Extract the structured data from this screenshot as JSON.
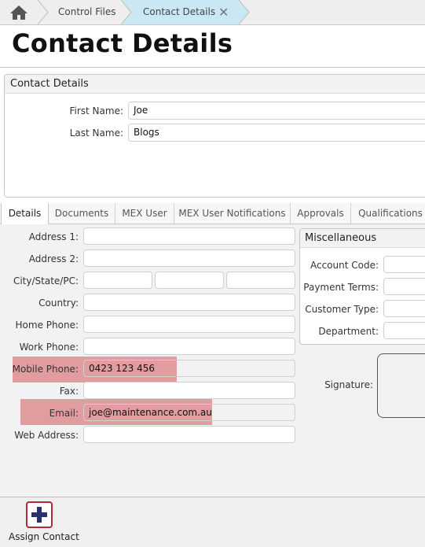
{
  "breadcrumb": {
    "home_icon": "home-icon",
    "items": [
      {
        "label": "Control Files"
      },
      {
        "label": "Contact Details"
      }
    ],
    "close_icon": "close-icon"
  },
  "page": {
    "title": "Contact Details"
  },
  "contact_panel": {
    "title": "Contact Details",
    "first_name_label": "First Name:",
    "first_name_value": "Joe",
    "last_name_label": "Last Name:",
    "last_name_value": "Blogs"
  },
  "tabs": [
    {
      "label": "Details",
      "active": true
    },
    {
      "label": "Documents"
    },
    {
      "label": "MEX User"
    },
    {
      "label": "MEX User Notifications"
    },
    {
      "label": "Approvals"
    },
    {
      "label": "Qualifications"
    }
  ],
  "details": {
    "address1_label": "Address 1:",
    "address1_value": "",
    "address2_label": "Address 2:",
    "address2_value": "",
    "city_state_pc_label": "City/State/PC:",
    "country_label": "Country:",
    "home_phone_label": "Home Phone:",
    "work_phone_label": "Work Phone:",
    "mobile_phone_label": "Mobile Phone:",
    "mobile_phone_value": "0423 123 456",
    "fax_label": "Fax:",
    "email_label": "Email:",
    "email_value": "joe@maintenance.com.au",
    "web_address_label": "Web Address:",
    "highlight_color": "#d9727a"
  },
  "misc": {
    "title": "Miscellaneous",
    "account_code_label": "Account Code:",
    "payment_terms_label": "Payment Terms:",
    "customer_type_label": "Customer Type:",
    "department_label": "Department:"
  },
  "signature_label": "Signature:",
  "footer": {
    "assign_contact_label": "Assign Contact",
    "assign_icon": "plus-icon",
    "accent": "#b12a3c",
    "icon_color": "#2a2f6e"
  }
}
